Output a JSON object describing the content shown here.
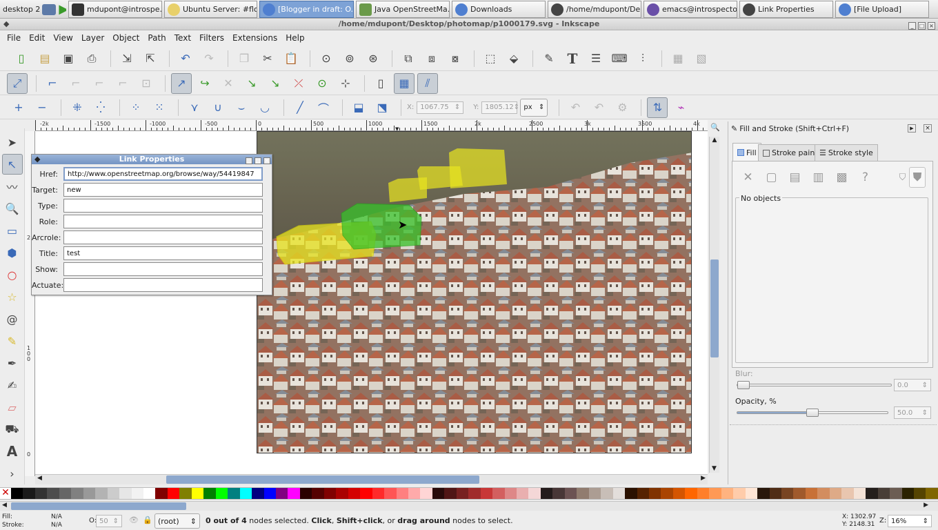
{
  "taskbar": {
    "desktop_label": "desktop 2",
    "tasks": [
      {
        "label": "mdupont@introspe..."
      },
      {
        "label": "Ubuntu Server: #flo..."
      },
      {
        "label": "[Blogger in draft: O..."
      },
      {
        "label": "Java OpenStreetMa..."
      },
      {
        "label": "Downloads"
      },
      {
        "label": "/home/mdupont/De..."
      },
      {
        "label": "emacs@introspecto..."
      },
      {
        "label": "Link Properties"
      },
      {
        "label": "[File Upload]"
      }
    ]
  },
  "window": {
    "title": "/home/mdupont/Desktop/photomap/p1000179.svg - Inkscape"
  },
  "menu": [
    "File",
    "Edit",
    "View",
    "Layer",
    "Object",
    "Path",
    "Text",
    "Filters",
    "Extensions",
    "Help"
  ],
  "node_toolbar": {
    "x_label": "X:",
    "x_value": "1067.75",
    "y_label": "Y:",
    "y_value": "1805.12",
    "unit": "px"
  },
  "ruler": {
    "h_labels": [
      "-2k",
      "-1500",
      "-1000",
      "-500",
      "0",
      "500",
      "1000",
      "1500",
      "2k",
      "2500",
      "3k",
      "3500",
      "4k"
    ],
    "v_labels": [
      "2",
      "1",
      "0",
      "0",
      "0"
    ]
  },
  "link_dialog": {
    "title": "Link Properties",
    "fields": [
      {
        "label": "Href:",
        "value": "http://www.openstreetmap.org/browse/way/54419847"
      },
      {
        "label": "Target:",
        "value": "new"
      },
      {
        "label": "Type:",
        "value": ""
      },
      {
        "label": "Role:",
        "value": ""
      },
      {
        "label": "Arcrole:",
        "value": ""
      },
      {
        "label": "Title:",
        "value": "test"
      },
      {
        "label": "Show:",
        "value": ""
      },
      {
        "label": "Actuate:",
        "value": ""
      }
    ]
  },
  "fill_stroke": {
    "title": "Fill and Stroke (Shift+Ctrl+F)",
    "tabs": [
      "Fill",
      "Stroke paint",
      "Stroke style"
    ],
    "no_objects": "No objects",
    "blur_label": "Blur:",
    "blur_value": "0.0",
    "opacity_label": "Opacity, %",
    "opacity_value": "50.0"
  },
  "status": {
    "fill_label": "Fill:",
    "fill_value": "N/A",
    "stroke_label": "Stroke:",
    "stroke_value": "N/A",
    "opacity_label": "O:",
    "opacity_value": "50",
    "layer": "(root)",
    "message_parts": [
      "0 out of ",
      "4",
      " nodes selected. ",
      "Click",
      ", ",
      "Shift+click",
      ", or ",
      "drag around",
      " nodes to select."
    ],
    "x_coord": "X: 1302.97",
    "y_coord": "Y: 2148.31",
    "zoom_label": "Z:",
    "zoom": "16%"
  },
  "palette_colors": [
    "#000000",
    "#1a1a1a",
    "#333333",
    "#4d4d4d",
    "#666666",
    "#808080",
    "#999999",
    "#b3b3b3",
    "#cccccc",
    "#e6e6e6",
    "#f2f2f2",
    "#ffffff",
    "#800000",
    "#ff0000",
    "#808000",
    "#ffff00",
    "#008000",
    "#00ff00",
    "#008080",
    "#00ffff",
    "#000080",
    "#0000ff",
    "#800080",
    "#ff00ff",
    "#2b0000",
    "#550000",
    "#800000",
    "#aa0000",
    "#d40000",
    "#ff0000",
    "#ff2a2a",
    "#ff5555",
    "#ff8080",
    "#ffaaaa",
    "#ffd5d5",
    "#280b0b",
    "#501616",
    "#782121",
    "#a02c2c",
    "#c83737",
    "#d35f5f",
    "#de8787",
    "#e9afaf",
    "#f4d7d7",
    "#241c1c",
    "#483737",
    "#6c5353",
    "#917c6f",
    "#ac9d93",
    "#c8beb7",
    "#e3dedb",
    "#2b1100",
    "#552200",
    "#803300",
    "#aa4400",
    "#d45500",
    "#ff6600",
    "#ff7f2a",
    "#ff9955",
    "#ffb380",
    "#ffccaa",
    "#ffe6d5",
    "#28170b",
    "#502d16",
    "#784421",
    "#a05a2c",
    "#c87137",
    "#d38d5f",
    "#deaa87",
    "#e9c6af",
    "#f4e3d7",
    "#241f1c",
    "#483e37",
    "#6c5d53",
    "#2b2200",
    "#554400",
    "#806600"
  ]
}
